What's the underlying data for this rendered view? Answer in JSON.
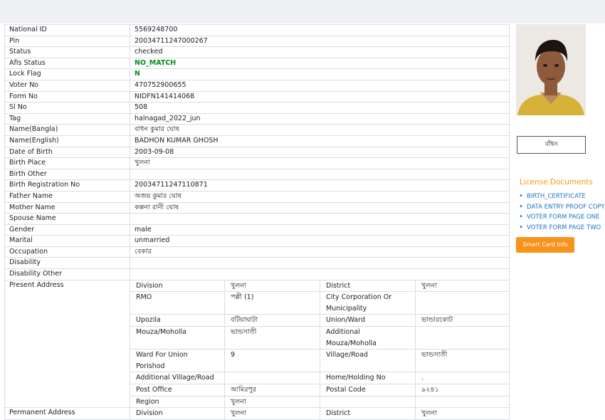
{
  "fields": [
    {
      "label": "National ID",
      "value": "5569248700"
    },
    {
      "label": "Pin",
      "value": "20034711247000267"
    },
    {
      "label": "Status",
      "value": "checked"
    },
    {
      "label": "Afis Status",
      "value": "NO_MATCH"
    },
    {
      "label": "Lock Flag",
      "value": "N"
    },
    {
      "label": "Voter No",
      "value": "470752900655"
    },
    {
      "label": "Form No",
      "value": "NIDFN141414068"
    },
    {
      "label": "Sl No",
      "value": "508"
    },
    {
      "label": "Tag",
      "value": "halnagad_2022_jun"
    },
    {
      "label": "Name(Bangla)",
      "value": "বাধন কুমার ঘোষ"
    },
    {
      "label": "Name(English)",
      "value": "BADHON KUMAR GHOSH"
    },
    {
      "label": "Date of Birth",
      "value": "2003-09-08"
    },
    {
      "label": "Birth Place",
      "value": "খুলনা"
    },
    {
      "label": "Birth Other",
      "value": ""
    },
    {
      "label": "Birth Registration No",
      "value": "20034711247110871"
    },
    {
      "label": "Father Name",
      "value": "অজয় কুমার ঘোষ"
    },
    {
      "label": "Mother Name",
      "value": "কল্পনা রানী ঘোষ"
    },
    {
      "label": "Spouse Name",
      "value": ""
    },
    {
      "label": "Gender",
      "value": "male"
    },
    {
      "label": "Marital",
      "value": "unmarried"
    },
    {
      "label": "Occupation",
      "value": "বেকার"
    },
    {
      "label": "Disability",
      "value": ""
    },
    {
      "label": "Disability Other",
      "value": ""
    }
  ],
  "present_address": {
    "label": "Present Address",
    "rows": [
      [
        "Division",
        "খুলনা",
        "District",
        "খুলনা"
      ],
      [
        "RMO",
        "পল্লী (1)",
        "City Corporation Or Municipality",
        ""
      ],
      [
        "Upozila",
        "বটিয়াঘাটা",
        "Union/Ward",
        "ভান্ডারকোট"
      ],
      [
        "Mouza/Moholla",
        "ভান্ডসাতী",
        "Additional Mouza/Moholla",
        ""
      ],
      [
        "Ward For Union Porishod",
        "9",
        "Village/Road",
        "ভান্ডসাতী"
      ],
      [
        "Additional Village/Road",
        "",
        "Home/Holding No",
        "."
      ],
      [
        "Post Office",
        "আমিরপুর",
        "Postal Code",
        "৯২৪১"
      ],
      [
        "Region",
        "খুলনা",
        "",
        ""
      ]
    ]
  },
  "permanent_address": {
    "label": "Permanent Address",
    "rows": [
      [
        "Division",
        "খুলনা",
        "District",
        "খুলনা"
      ]
    ]
  },
  "sidebar": {
    "sign_label": "বাঁধন",
    "docs_title": "License Documents",
    "docs": [
      "BIRTH_CERTIFICATE",
      "DATA ENTRY PROOF COPY",
      "VOTER FORM PAGE ONE",
      "VOTER FORM PAGE TWO"
    ],
    "smart_card_label": "Smart Card Info"
  },
  "colors": {
    "accent": "#f7941d",
    "link": "#1f74c4",
    "match": "#0a8a1c"
  }
}
